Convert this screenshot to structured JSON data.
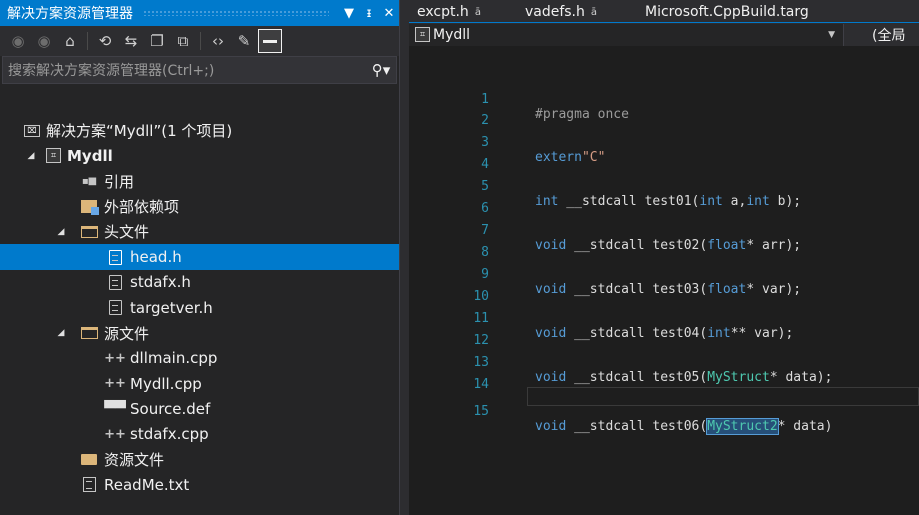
{
  "solution_explorer": {
    "title": "解决方案资源管理器",
    "title_buttons": [
      "▾",
      "Ⅱ",
      "✕"
    ],
    "search_placeholder": "搜索解决方案资源管理器(Ctrl+;)",
    "solution_label": "解决方案“Mydll”(1 个项目)",
    "project_label": "Mydll",
    "items": {
      "references": "引用",
      "external_deps": "外部依赖项",
      "header_folder": "头文件",
      "head_h": "head.h",
      "stdafx_h": "stdafx.h",
      "targetver_h": "targetver.h",
      "source_folder": "源文件",
      "dllmain_cpp": "dllmain.cpp",
      "mydll_cpp": "Mydll.cpp",
      "source_def": "Source.def",
      "stdafx_cpp": "stdafx.cpp",
      "resource_folder": "资源文件",
      "readme": "ReadMe.txt"
    },
    "selected_item": "head.h"
  },
  "editor": {
    "tabs": [
      {
        "label": "excpt.h",
        "pin": "ā"
      },
      {
        "label": "vadefs.h",
        "pin": "ā"
      },
      {
        "label": "Microsoft.CppBuild.targ"
      }
    ],
    "nav_project": "Mydll",
    "nav_scope": "(全局",
    "line_numbers": [
      "1",
      "2",
      "3",
      "4",
      "5",
      "6",
      "7",
      "8",
      "9",
      "10",
      "11",
      "12",
      "13",
      "14",
      "15"
    ],
    "code": {
      "l1": "#pragma once",
      "l3_kw": "extern",
      "l3_str": "\"C\"",
      "l5_a": "int",
      "l5_b": " __stdcall test01(",
      "l5_c": "int",
      "l5_d": " a,",
      "l5_e": "int",
      "l5_f": " b);",
      "l7_a": "void",
      "l7_b": " __stdcall test02(",
      "l7_c": "float",
      "l7_d": "* arr);",
      "l9_a": "void",
      "l9_b": " __stdcall test03(",
      "l9_c": "float",
      "l9_d": "* var);",
      "l11_a": "void",
      "l11_b": " __stdcall test04(",
      "l11_c": "int",
      "l11_d": "** var);",
      "l13_a": "void",
      "l13_b": " __stdcall test05(",
      "l13_c": "MyStruct",
      "l13_d": "* data);",
      "l15_a": "void",
      "l15_b": " __stdcall test06(",
      "l15_c": "MyStruct2",
      "l15_d": "* data)"
    }
  }
}
